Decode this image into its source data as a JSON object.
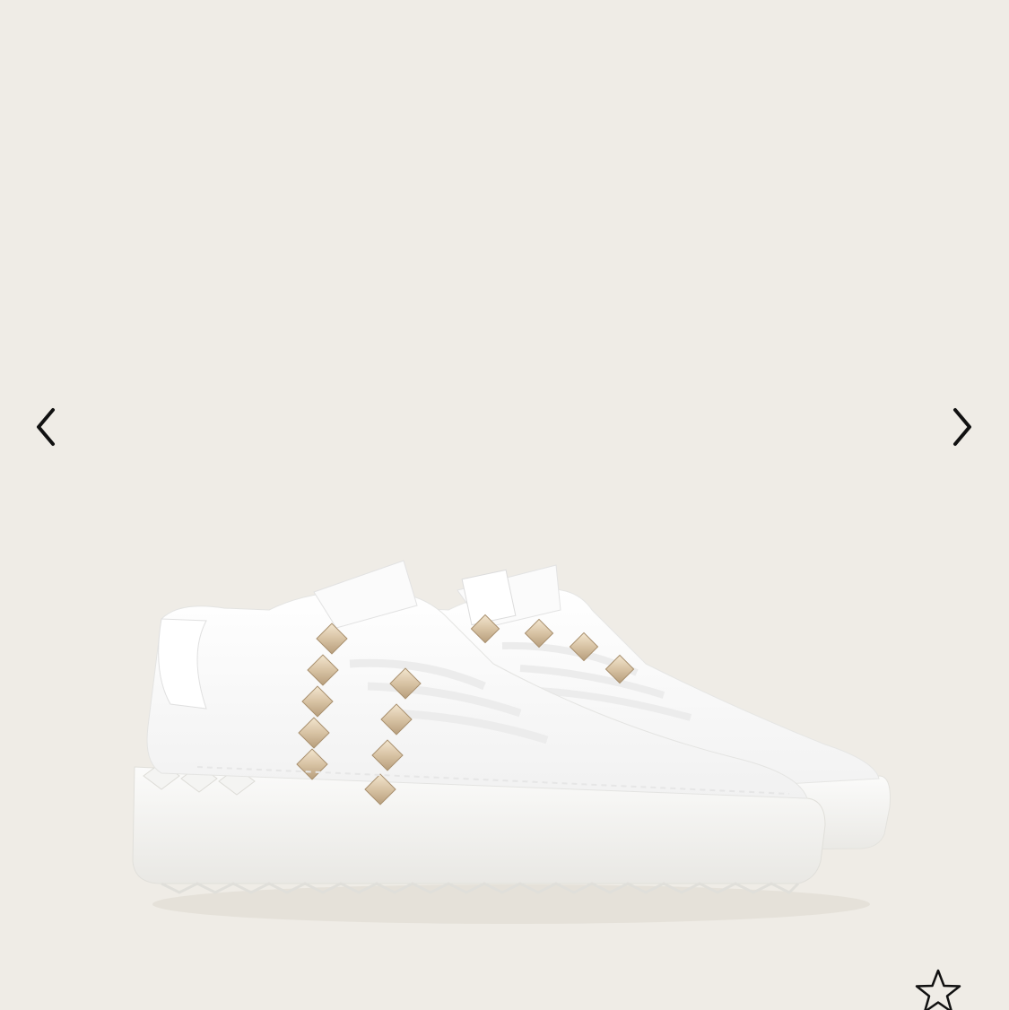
{
  "gallery": {
    "background": "#efece6",
    "image_subject": "white-leather-sneakers-with-gold-studs",
    "prev_icon": "chevron-left-icon",
    "next_icon": "chevron-right-icon",
    "favorite_icon": "star-outline-icon",
    "stud_color": "#d8c3a4"
  }
}
